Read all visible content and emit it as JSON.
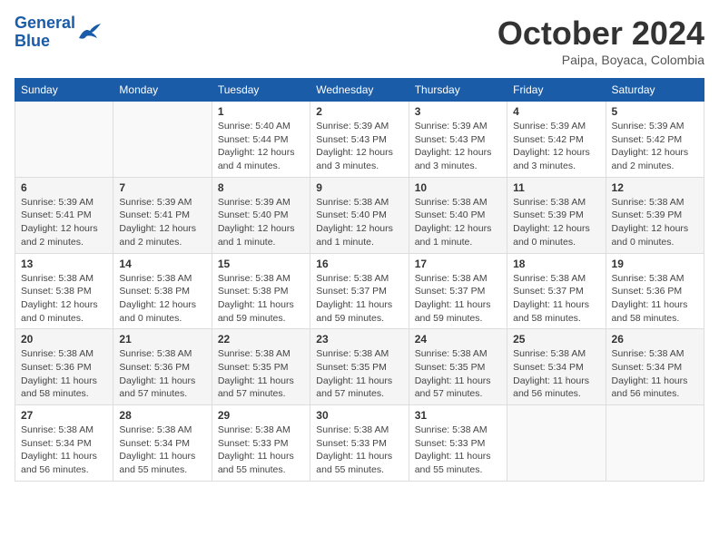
{
  "header": {
    "logo": {
      "line1": "General",
      "line2": "Blue"
    },
    "title": "October 2024",
    "location": "Paipa, Boyaca, Colombia"
  },
  "weekdays": [
    "Sunday",
    "Monday",
    "Tuesday",
    "Wednesday",
    "Thursday",
    "Friday",
    "Saturday"
  ],
  "weeks": [
    [
      {
        "day": "",
        "info": ""
      },
      {
        "day": "",
        "info": ""
      },
      {
        "day": "1",
        "sunrise": "5:40 AM",
        "sunset": "5:44 PM",
        "daylight": "12 hours and 4 minutes."
      },
      {
        "day": "2",
        "sunrise": "5:39 AM",
        "sunset": "5:43 PM",
        "daylight": "12 hours and 3 minutes."
      },
      {
        "day": "3",
        "sunrise": "5:39 AM",
        "sunset": "5:43 PM",
        "daylight": "12 hours and 3 minutes."
      },
      {
        "day": "4",
        "sunrise": "5:39 AM",
        "sunset": "5:42 PM",
        "daylight": "12 hours and 3 minutes."
      },
      {
        "day": "5",
        "sunrise": "5:39 AM",
        "sunset": "5:42 PM",
        "daylight": "12 hours and 2 minutes."
      }
    ],
    [
      {
        "day": "6",
        "sunrise": "5:39 AM",
        "sunset": "5:41 PM",
        "daylight": "12 hours and 2 minutes."
      },
      {
        "day": "7",
        "sunrise": "5:39 AM",
        "sunset": "5:41 PM",
        "daylight": "12 hours and 2 minutes."
      },
      {
        "day": "8",
        "sunrise": "5:39 AM",
        "sunset": "5:40 PM",
        "daylight": "12 hours and 1 minute."
      },
      {
        "day": "9",
        "sunrise": "5:38 AM",
        "sunset": "5:40 PM",
        "daylight": "12 hours and 1 minute."
      },
      {
        "day": "10",
        "sunrise": "5:38 AM",
        "sunset": "5:40 PM",
        "daylight": "12 hours and 1 minute."
      },
      {
        "day": "11",
        "sunrise": "5:38 AM",
        "sunset": "5:39 PM",
        "daylight": "12 hours and 0 minutes."
      },
      {
        "day": "12",
        "sunrise": "5:38 AM",
        "sunset": "5:39 PM",
        "daylight": "12 hours and 0 minutes."
      }
    ],
    [
      {
        "day": "13",
        "sunrise": "5:38 AM",
        "sunset": "5:38 PM",
        "daylight": "12 hours and 0 minutes."
      },
      {
        "day": "14",
        "sunrise": "5:38 AM",
        "sunset": "5:38 PM",
        "daylight": "12 hours and 0 minutes."
      },
      {
        "day": "15",
        "sunrise": "5:38 AM",
        "sunset": "5:38 PM",
        "daylight": "11 hours and 59 minutes."
      },
      {
        "day": "16",
        "sunrise": "5:38 AM",
        "sunset": "5:37 PM",
        "daylight": "11 hours and 59 minutes."
      },
      {
        "day": "17",
        "sunrise": "5:38 AM",
        "sunset": "5:37 PM",
        "daylight": "11 hours and 59 minutes."
      },
      {
        "day": "18",
        "sunrise": "5:38 AM",
        "sunset": "5:37 PM",
        "daylight": "11 hours and 58 minutes."
      },
      {
        "day": "19",
        "sunrise": "5:38 AM",
        "sunset": "5:36 PM",
        "daylight": "11 hours and 58 minutes."
      }
    ],
    [
      {
        "day": "20",
        "sunrise": "5:38 AM",
        "sunset": "5:36 PM",
        "daylight": "11 hours and 58 minutes."
      },
      {
        "day": "21",
        "sunrise": "5:38 AM",
        "sunset": "5:36 PM",
        "daylight": "11 hours and 57 minutes."
      },
      {
        "day": "22",
        "sunrise": "5:38 AM",
        "sunset": "5:35 PM",
        "daylight": "11 hours and 57 minutes."
      },
      {
        "day": "23",
        "sunrise": "5:38 AM",
        "sunset": "5:35 PM",
        "daylight": "11 hours and 57 minutes."
      },
      {
        "day": "24",
        "sunrise": "5:38 AM",
        "sunset": "5:35 PM",
        "daylight": "11 hours and 57 minutes."
      },
      {
        "day": "25",
        "sunrise": "5:38 AM",
        "sunset": "5:34 PM",
        "daylight": "11 hours and 56 minutes."
      },
      {
        "day": "26",
        "sunrise": "5:38 AM",
        "sunset": "5:34 PM",
        "daylight": "11 hours and 56 minutes."
      }
    ],
    [
      {
        "day": "27",
        "sunrise": "5:38 AM",
        "sunset": "5:34 PM",
        "daylight": "11 hours and 56 minutes."
      },
      {
        "day": "28",
        "sunrise": "5:38 AM",
        "sunset": "5:34 PM",
        "daylight": "11 hours and 55 minutes."
      },
      {
        "day": "29",
        "sunrise": "5:38 AM",
        "sunset": "5:33 PM",
        "daylight": "11 hours and 55 minutes."
      },
      {
        "day": "30",
        "sunrise": "5:38 AM",
        "sunset": "5:33 PM",
        "daylight": "11 hours and 55 minutes."
      },
      {
        "day": "31",
        "sunrise": "5:38 AM",
        "sunset": "5:33 PM",
        "daylight": "11 hours and 55 minutes."
      },
      {
        "day": "",
        "info": ""
      },
      {
        "day": "",
        "info": ""
      }
    ]
  ],
  "labels": {
    "sunrise": "Sunrise:",
    "sunset": "Sunset:",
    "daylight": "Daylight:"
  }
}
